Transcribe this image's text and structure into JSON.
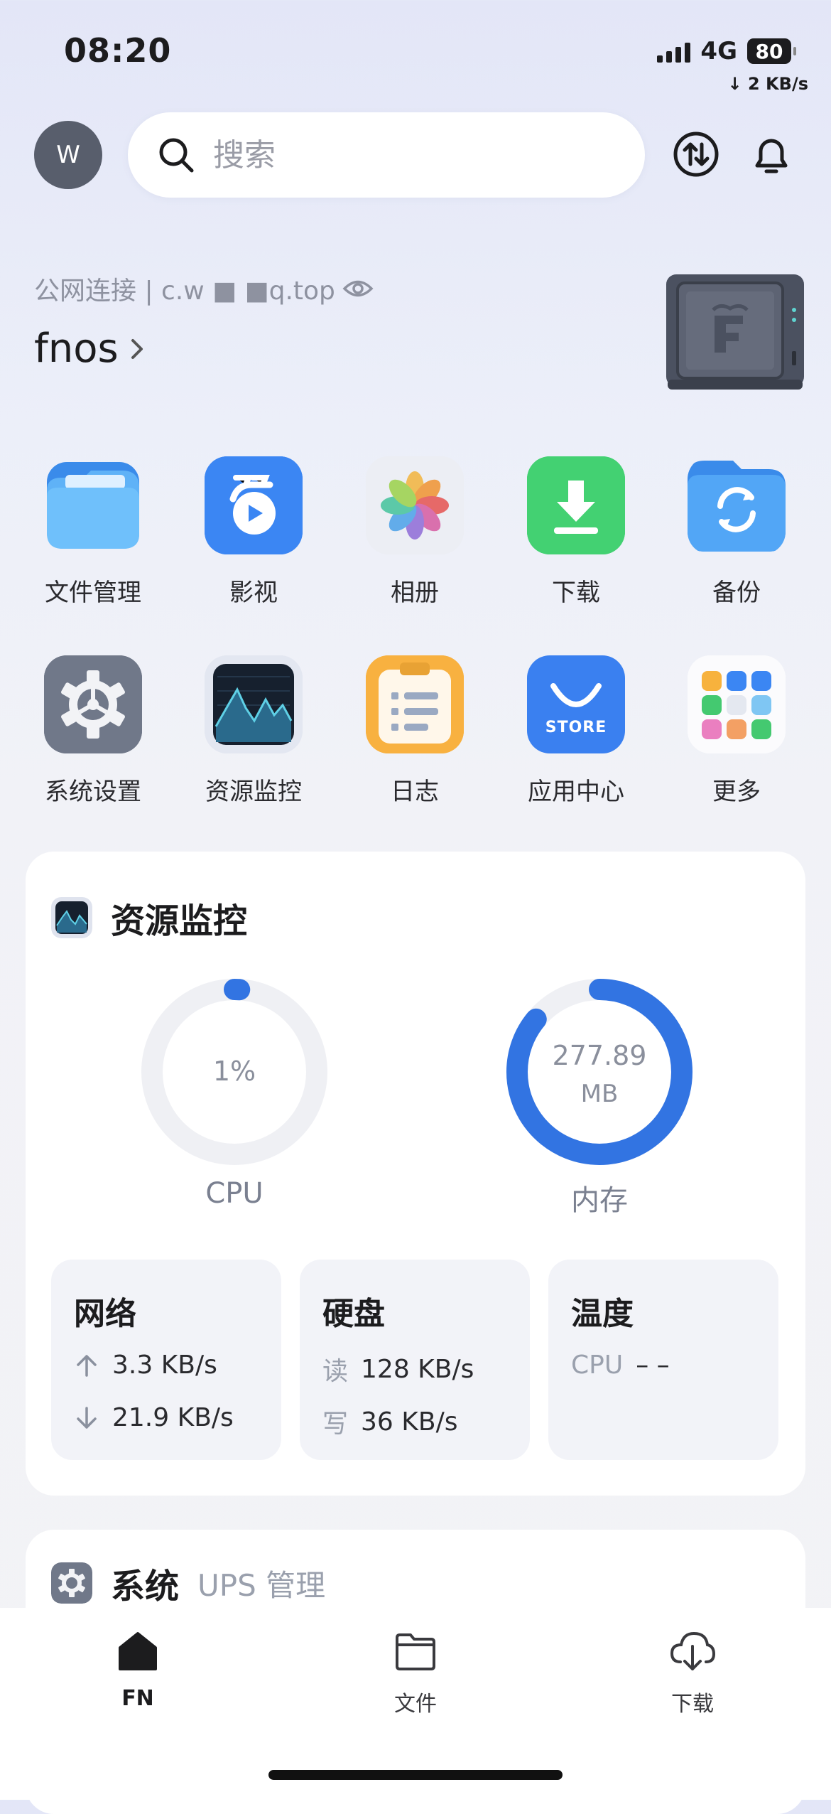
{
  "status_bar": {
    "time": "08:20",
    "network": "4G",
    "battery": "80",
    "speed": "2 KB/s"
  },
  "header": {
    "avatar_letter": "W",
    "search_placeholder": "搜索"
  },
  "server": {
    "connection": "公网连接 | c.w ■ ■q.top",
    "name": "fnos"
  },
  "apps": [
    {
      "label": "文件管理",
      "icon": "folder-icon"
    },
    {
      "label": "影视",
      "icon": "video-icon"
    },
    {
      "label": "相册",
      "icon": "photos-icon"
    },
    {
      "label": "下载",
      "icon": "download-icon"
    },
    {
      "label": "备份",
      "icon": "backup-icon"
    },
    {
      "label": "系统设置",
      "icon": "settings-gear-icon"
    },
    {
      "label": "资源监控",
      "icon": "monitor-icon"
    },
    {
      "label": "日志",
      "icon": "log-icon"
    },
    {
      "label": "应用中心",
      "icon": "store-icon"
    },
    {
      "label": "更多",
      "icon": "more-grid-icon"
    }
  ],
  "store_badge": "STORE",
  "resource_monitor": {
    "title": "资源监控",
    "cpu": {
      "percent_text": "1%",
      "label": "CPU",
      "fraction": 0.01
    },
    "memory": {
      "value": "277.89",
      "unit": "MB",
      "label": "内存",
      "fraction": 0.86
    },
    "network": {
      "title": "网络",
      "up": "3.3 KB/s",
      "down": "21.9 KB/s"
    },
    "disk": {
      "title": "硬盘",
      "read_label": "读",
      "read": "128 KB/s",
      "write_label": "写",
      "write": "36 KB/s"
    },
    "temperature": {
      "title": "温度",
      "cpu_label": "CPU",
      "cpu_value": "– –"
    }
  },
  "system_card": {
    "title": "系统",
    "subtitle": "UPS 管理"
  },
  "tabs": [
    {
      "label": "FN"
    },
    {
      "label": "文件"
    },
    {
      "label": "下载"
    }
  ],
  "colors": {
    "accent": "#3274e2",
    "ring_track": "#eff0f4"
  }
}
